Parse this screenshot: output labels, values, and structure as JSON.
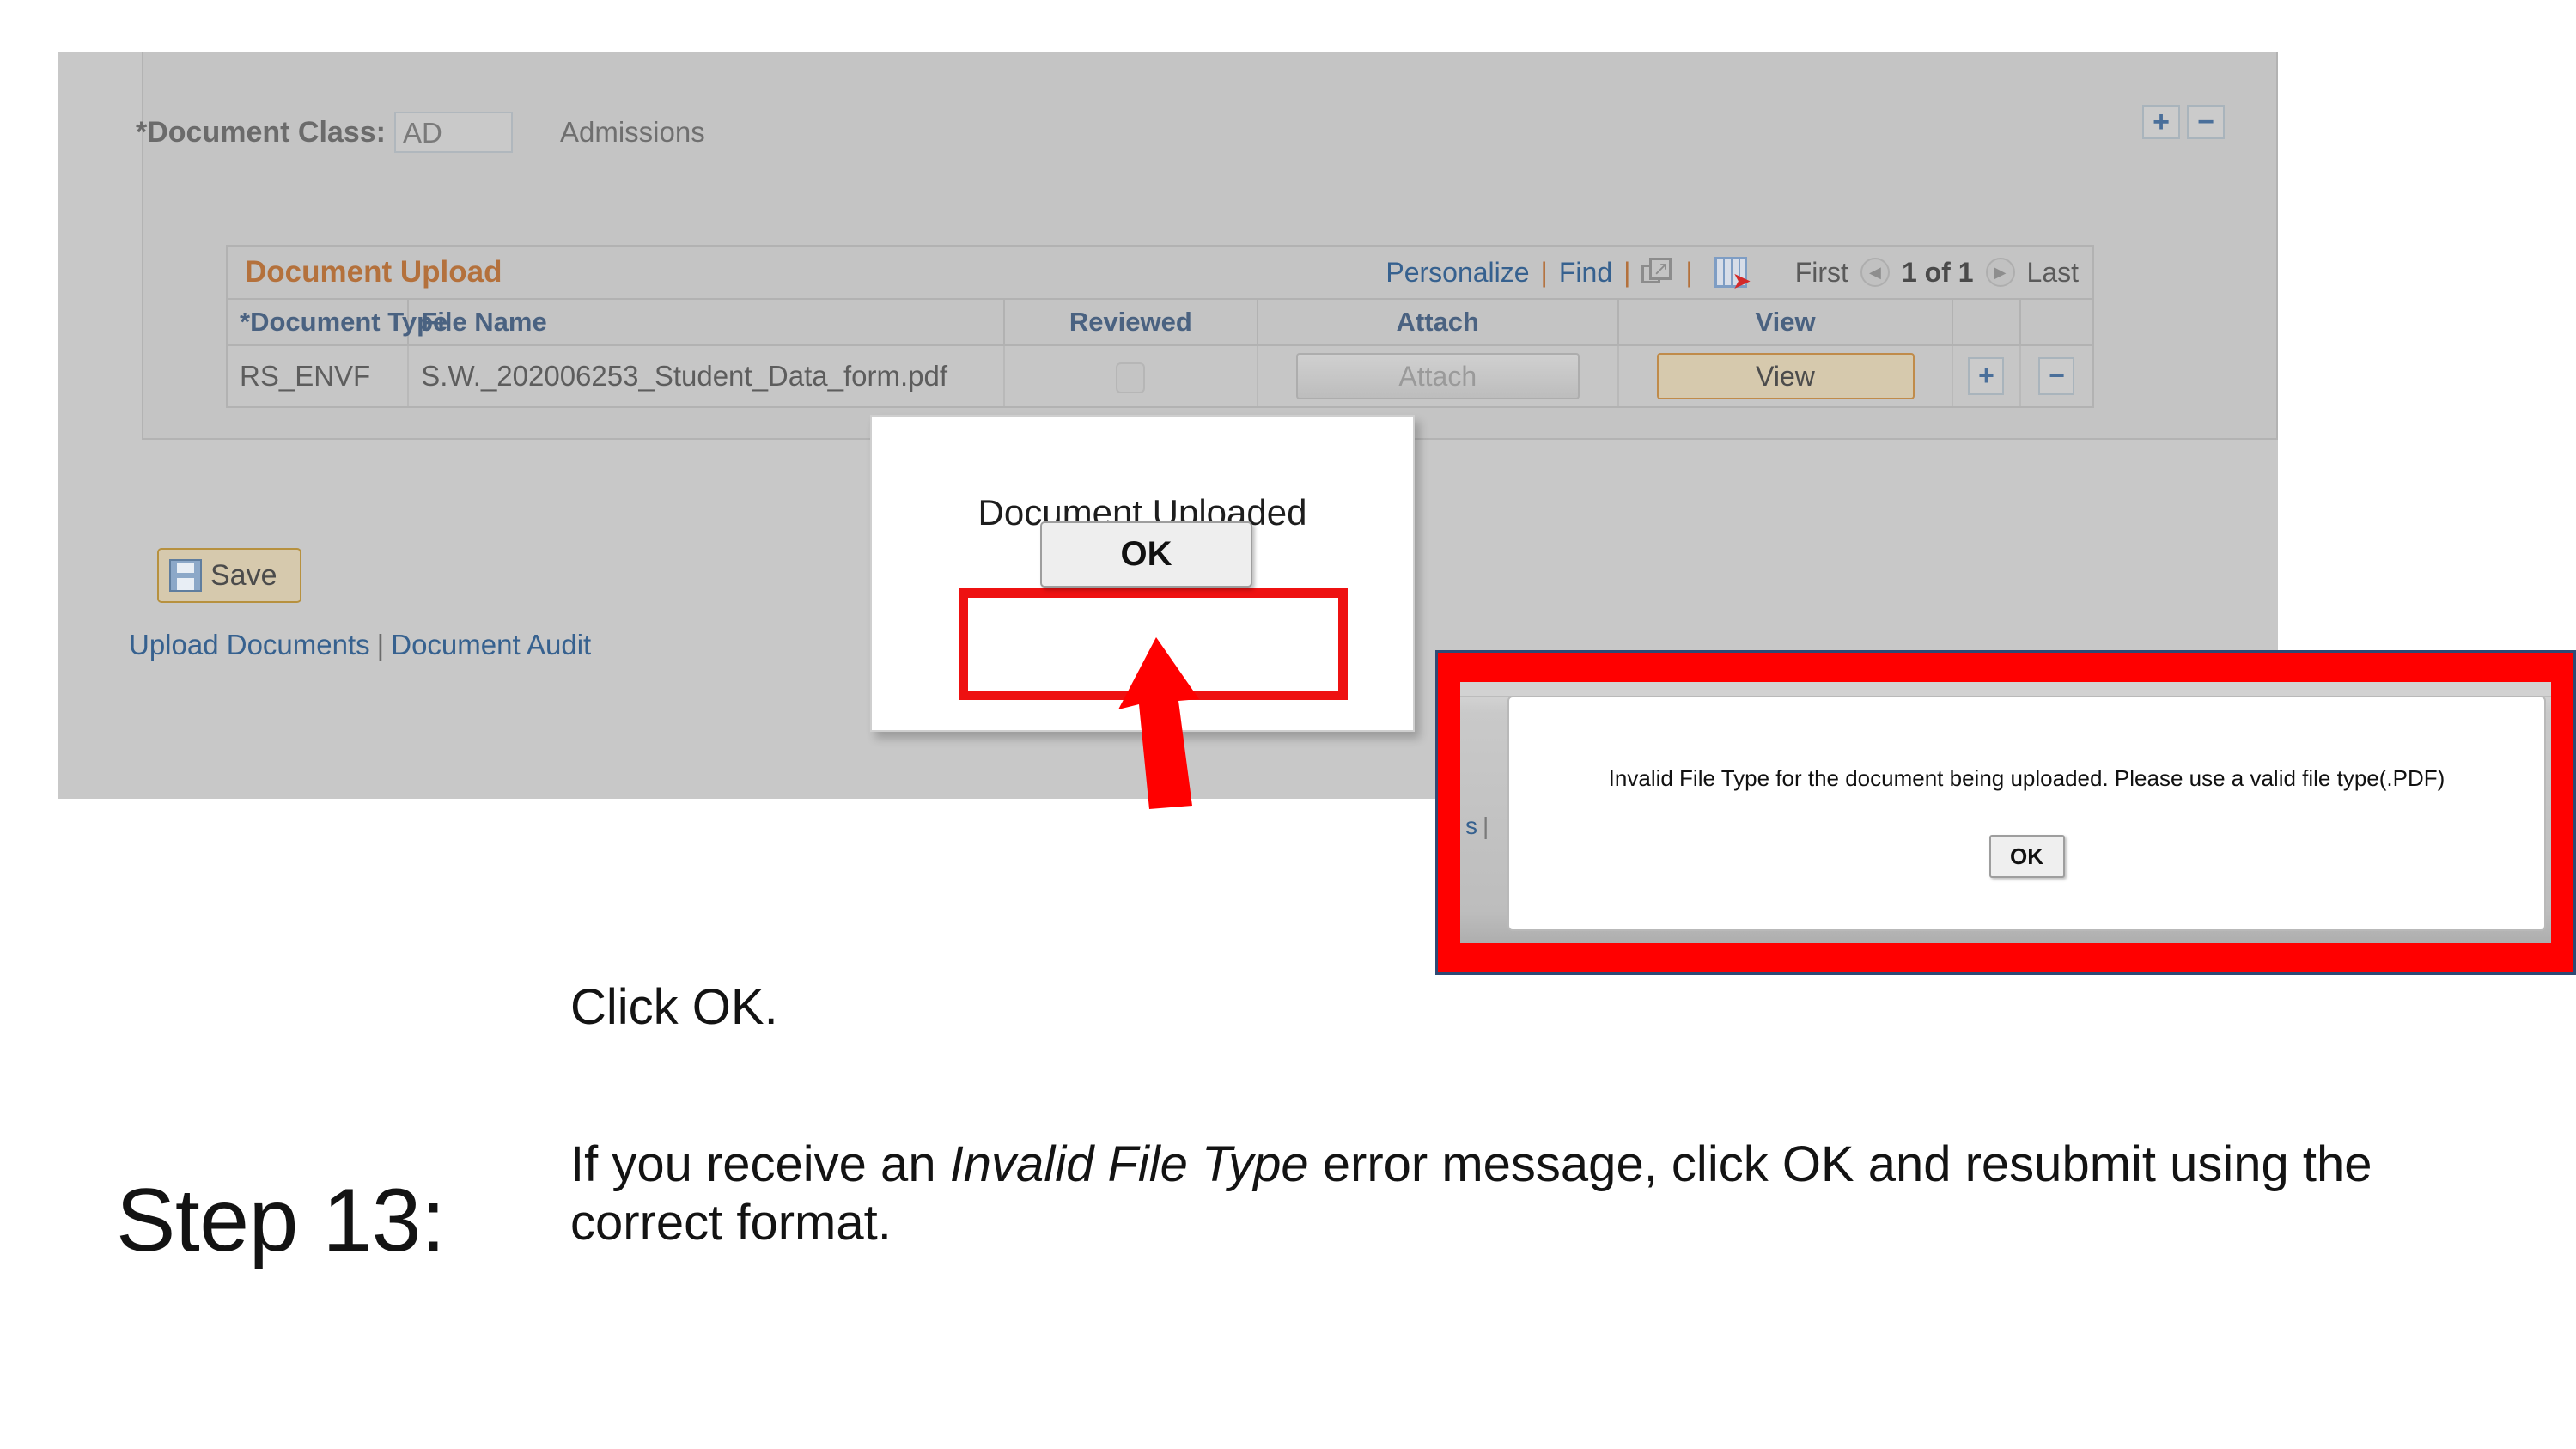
{
  "panel": {
    "document_class": {
      "label": "*Document Class:",
      "value": "AD",
      "description": "Admissions"
    },
    "section_buttons": {
      "add": "+",
      "remove": "−"
    }
  },
  "grid": {
    "title": "Document Upload",
    "toolbar": {
      "personalize": "Personalize",
      "find": "Find",
      "separator": "|",
      "expand_icon": "expand-window-icon",
      "download_icon": "grid-download-icon"
    },
    "pager": {
      "first": "First",
      "prev_icon": "chevron-left-icon",
      "count": "1 of 1",
      "next_icon": "chevron-right-icon",
      "last": "Last"
    },
    "columns": [
      "*Document Type",
      "File Name",
      "Reviewed",
      "Attach",
      "View"
    ],
    "rows": [
      {
        "document_type": "RS_ENVF",
        "file_name": "S.W._202006253_Student_Data_form.pdf",
        "reviewed": false,
        "attach_label": "Attach",
        "attach_disabled": true,
        "view_label": "View",
        "add_label": "+",
        "remove_label": "−"
      }
    ]
  },
  "actions": {
    "save_label": "Save",
    "save_icon": "floppy-disk-icon",
    "links": [
      "Upload Documents",
      "Document Audit"
    ],
    "link_separator": "|"
  },
  "modal_uploaded": {
    "message": "Document Uploaded",
    "ok_label": "OK",
    "highlight_color": "#ee1111",
    "arrow": "red-up-arrow"
  },
  "error_dialog": {
    "message": "Invalid File Type for the document being uploaded. Please use a valid file type(.PDF)",
    "ok_label": "OK",
    "frame_color": "#ff0000",
    "background_link_fragment": "s",
    "background_link_separator": "|"
  },
  "caption": {
    "click_ok": "Click OK.",
    "step_label": "Step 13:",
    "step_text_part1": "If you receive an ",
    "step_text_italic": "Invalid File Type",
    "step_text_part2": " error message, click OK and resubmit using the correct format."
  }
}
